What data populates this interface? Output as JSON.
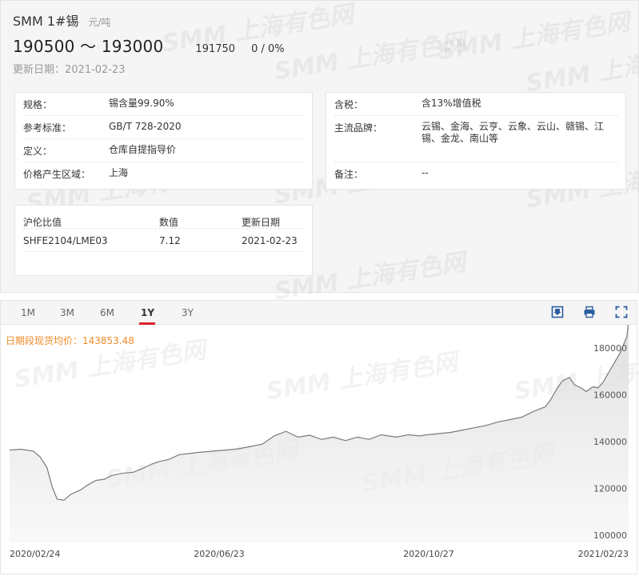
{
  "header": {
    "title": "SMM 1#锡",
    "unit": "元/吨",
    "price_range": "190500 ～ 193000",
    "avg_price": "191750",
    "change": "0 / 0%",
    "update_label": "更新日期：",
    "update_date": "2021-02-23"
  },
  "watermark": "SMM 上海有色网",
  "specs_left": [
    {
      "key": "规格：",
      "value": "锡含量99.90%"
    },
    {
      "key": "参考标准：",
      "value": "GB/T 728-2020"
    },
    {
      "key": "定义：",
      "value": "仓库自提指导价"
    },
    {
      "key": "价格产生区域：",
      "value": "上海"
    }
  ],
  "specs_right": [
    {
      "key": "含税：",
      "value": "含13%增值税"
    },
    {
      "key": "主流品牌：",
      "value_line1": "云锡、金海、云亨、云象、云山、赣锡、江",
      "value_line2": "锡、金龙、南山等"
    },
    {
      "key": "备注：",
      "value": "--"
    }
  ],
  "ratio_table": {
    "headers": [
      "沪伦比值",
      "数值",
      "更新日期"
    ],
    "row": [
      "SHFE2104/LME03",
      "7.12",
      "2021-02-23"
    ]
  },
  "tabs": [
    "1M",
    "3M",
    "6M",
    "1Y",
    "3Y"
  ],
  "active_tab": "1Y",
  "toolbar_icons": [
    "download-image-icon",
    "print-icon",
    "fullscreen-icon"
  ],
  "colors": {
    "accent_red": "#d9252a",
    "avg_orange": "#f08c2a",
    "line_gray": "#7a7a7a"
  },
  "chart_data": {
    "type": "area",
    "title": "",
    "legend": "日期段现货均价：143853.48",
    "ylim": [
      97000,
      190000
    ],
    "yticks": [
      100000,
      120000,
      140000,
      160000,
      180000
    ],
    "ytick_labels": [
      "100000",
      "120000",
      "140000",
      "160000",
      "180000"
    ],
    "xtick_labels": [
      "2020/02/24",
      "2020/06/23",
      "2020/10/27",
      "2021/02/23"
    ],
    "x_start": "2020-02-24",
    "x_end": "2021-02-23",
    "grid": false,
    "series": [
      {
        "points": [
          [
            "2020-02-24",
            136500
          ],
          [
            "2020-03-02",
            136800
          ],
          [
            "2020-03-09",
            136000
          ],
          [
            "2020-03-13",
            133500
          ],
          [
            "2020-03-17",
            129000
          ],
          [
            "2020-03-20",
            121000
          ],
          [
            "2020-03-23",
            115500
          ],
          [
            "2020-03-27",
            115000
          ],
          [
            "2020-03-31",
            117500
          ],
          [
            "2020-04-06",
            119500
          ],
          [
            "2020-04-10",
            121500
          ],
          [
            "2020-04-15",
            123500
          ],
          [
            "2020-04-20",
            124000
          ],
          [
            "2020-04-24",
            125500
          ],
          [
            "2020-04-30",
            126500
          ],
          [
            "2020-05-07",
            127000
          ],
          [
            "2020-05-12",
            128500
          ],
          [
            "2020-05-18",
            130500
          ],
          [
            "2020-05-22",
            131500
          ],
          [
            "2020-05-28",
            132500
          ],
          [
            "2020-06-03",
            134500
          ],
          [
            "2020-06-09",
            135000
          ],
          [
            "2020-06-15",
            135500
          ],
          [
            "2020-06-23",
            136000
          ],
          [
            "2020-07-01",
            136500
          ],
          [
            "2020-07-08",
            137000
          ],
          [
            "2020-07-15",
            138000
          ],
          [
            "2020-07-22",
            139000
          ],
          [
            "2020-07-29",
            142500
          ],
          [
            "2020-08-05",
            144500
          ],
          [
            "2020-08-12",
            142000
          ],
          [
            "2020-08-19",
            142800
          ],
          [
            "2020-08-26",
            141000
          ],
          [
            "2020-09-02",
            142000
          ],
          [
            "2020-09-09",
            140500
          ],
          [
            "2020-09-16",
            142000
          ],
          [
            "2020-09-23",
            141000
          ],
          [
            "2020-09-30",
            143000
          ],
          [
            "2020-10-09",
            142000
          ],
          [
            "2020-10-16",
            143000
          ],
          [
            "2020-10-23",
            142500
          ],
          [
            "2020-10-27",
            143000
          ],
          [
            "2020-11-03",
            143500
          ],
          [
            "2020-11-10",
            144000
          ],
          [
            "2020-11-17",
            145000
          ],
          [
            "2020-11-24",
            146000
          ],
          [
            "2020-12-01",
            147000
          ],
          [
            "2020-12-08",
            148500
          ],
          [
            "2020-12-15",
            149500
          ],
          [
            "2020-12-22",
            150500
          ],
          [
            "2020-12-29",
            153000
          ],
          [
            "2021-01-05",
            155000
          ],
          [
            "2021-01-08",
            158000
          ],
          [
            "2021-01-12",
            163000
          ],
          [
            "2021-01-15",
            166000
          ],
          [
            "2021-01-19",
            167500
          ],
          [
            "2021-01-22",
            164500
          ],
          [
            "2021-01-26",
            163000
          ],
          [
            "2021-01-29",
            161500
          ],
          [
            "2021-02-02",
            163500
          ],
          [
            "2021-02-05",
            163000
          ],
          [
            "2021-02-08",
            165500
          ],
          [
            "2021-02-10",
            168000
          ],
          [
            "2021-02-18",
            178000
          ],
          [
            "2021-02-22",
            185000
          ],
          [
            "2021-02-23",
            191750
          ]
        ]
      }
    ]
  }
}
